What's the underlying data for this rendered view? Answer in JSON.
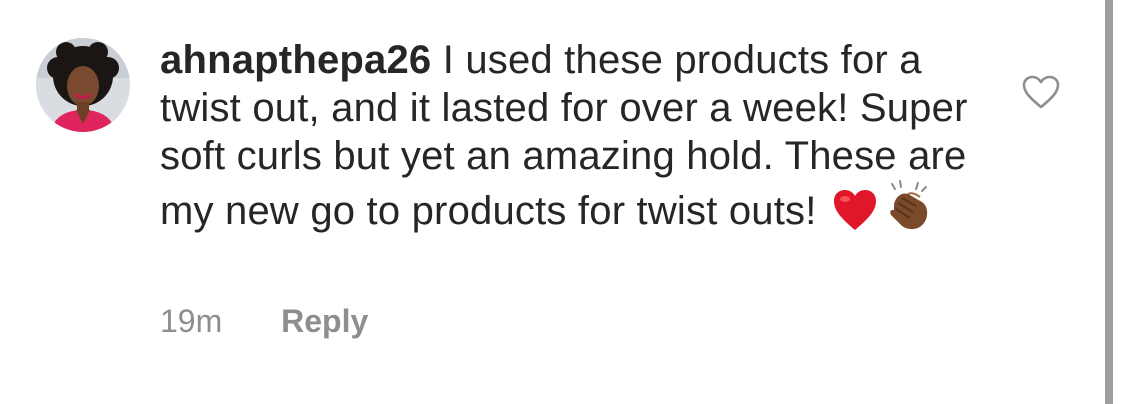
{
  "comment": {
    "username": "ahnapthepa26",
    "text": "I used these products for a twist out, and it lasted for over a week! Super soft curls but yet an amazing hold. These are my new go to products for twist outs!",
    "emojis": [
      "heart-emoji",
      "clapping-hands-emoji"
    ],
    "timestamp": "19m",
    "reply_label": "Reply",
    "like_icon": "heart-outline-icon"
  },
  "colors": {
    "text": "#262626",
    "meta": "#8e8e8e",
    "heart": "#e0162b"
  }
}
